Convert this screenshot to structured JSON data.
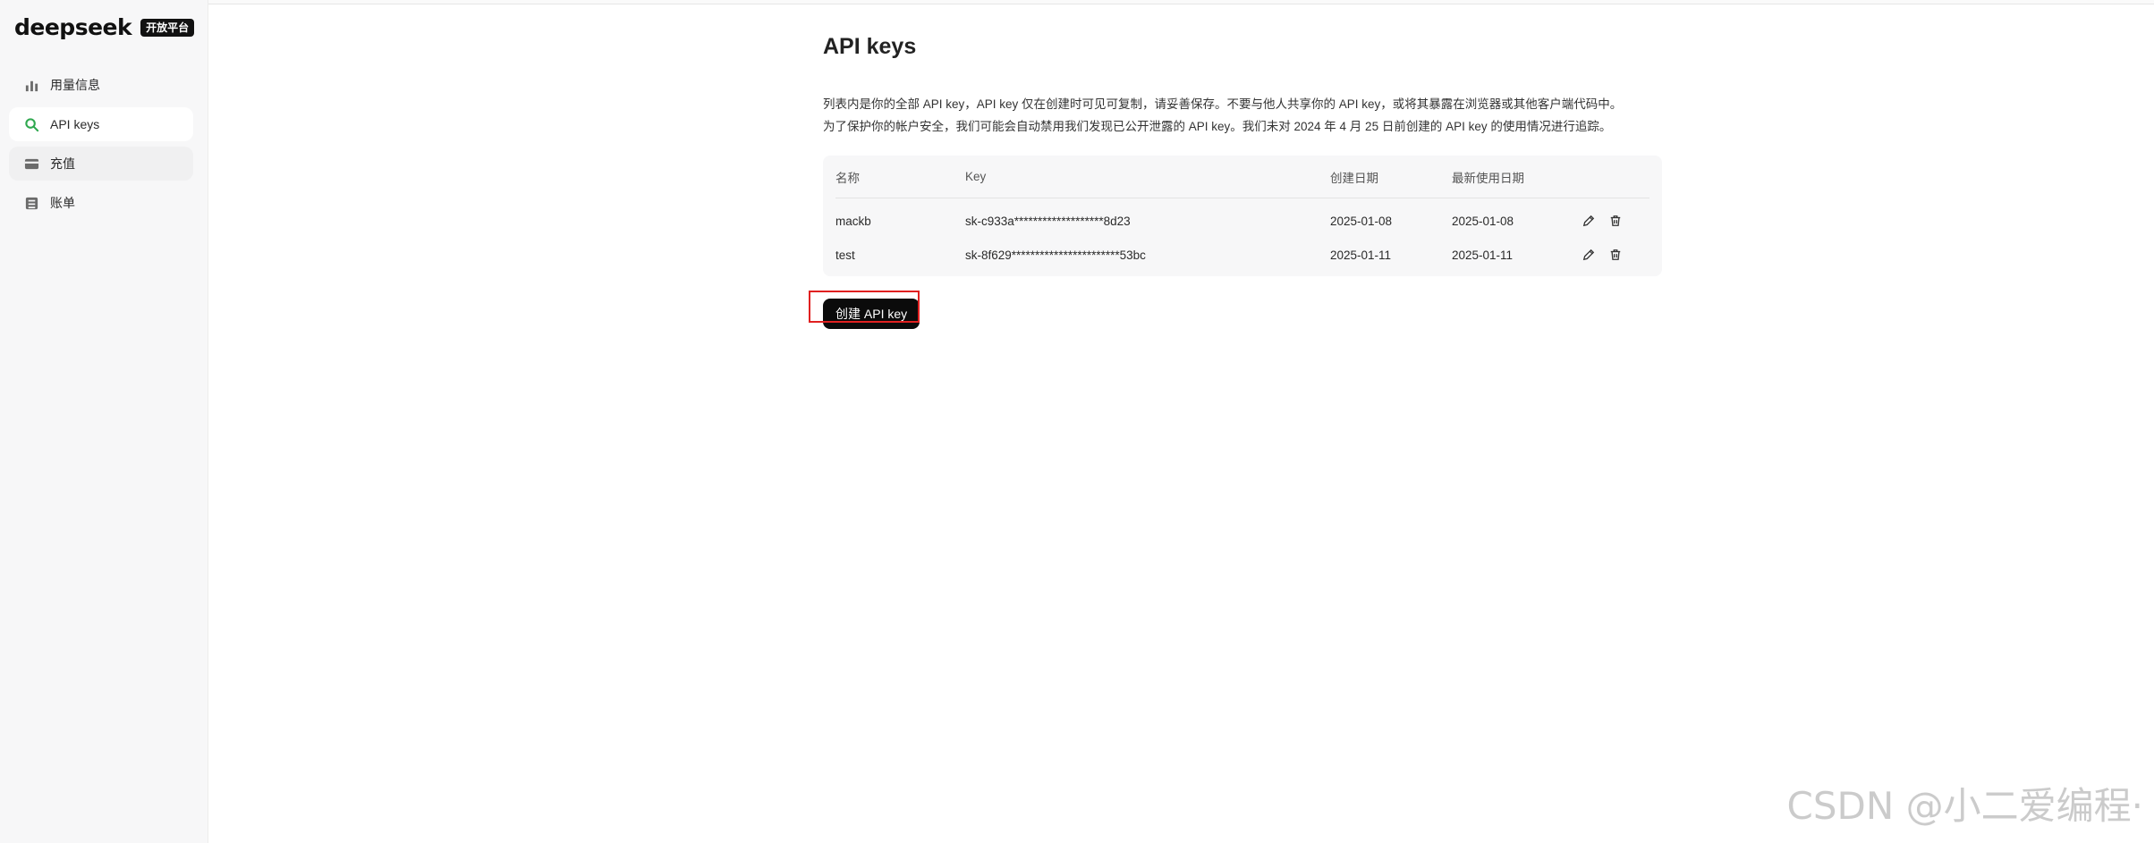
{
  "brand": {
    "logo": "deepseek",
    "badge": "开放平台"
  },
  "sidebar": {
    "items": [
      {
        "label": "用量信息",
        "icon": "bar-chart-icon",
        "active": false
      },
      {
        "label": "API keys",
        "icon": "search-icon",
        "active": true
      },
      {
        "label": "充值",
        "icon": "card-icon",
        "active": false
      },
      {
        "label": "账单",
        "icon": "bill-icon",
        "active": false
      }
    ]
  },
  "main": {
    "title": "API keys",
    "description": [
      "列表内是你的全部 API key，API key 仅在创建时可见可复制，请妥善保存。不要与他人共享你的 API key，或将其暴露在浏览器或其他客户端代码中。",
      "为了保护你的帐户安全，我们可能会自动禁用我们发现已公开泄露的 API key。我们未对 2024 年 4 月 25 日前创建的 API key 的使用情况进行追踪。"
    ],
    "table": {
      "headers": {
        "name": "名称",
        "key": "Key",
        "created": "创建日期",
        "last_used": "最新使用日期"
      },
      "rows": [
        {
          "name": "mackb",
          "key": "sk-c933a*******************8d23",
          "created": "2025-01-08",
          "last_used": "2025-01-08"
        },
        {
          "name": "test",
          "key": "sk-8f629***********************53bc",
          "created": "2025-01-11",
          "last_used": "2025-01-11"
        }
      ]
    },
    "create_button": "创建 API key"
  },
  "watermark": "CSDN @小二爱编程·",
  "colors": {
    "accent_green": "#2fa84f",
    "annotation_red": "#e02020",
    "button_bg": "#0b0b0b"
  }
}
